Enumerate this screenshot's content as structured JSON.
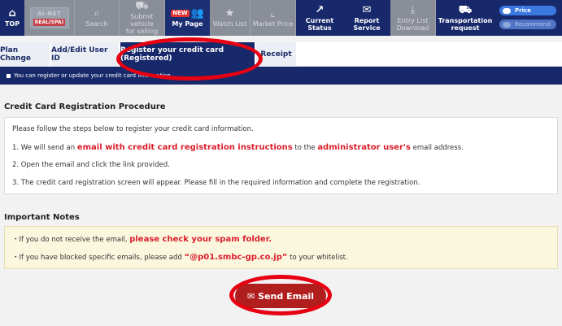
{
  "nav": {
    "top": "TOP",
    "logo_top": "AI-NET",
    "logo_bottom": "REAL(SPA)",
    "search": "Search",
    "submit_vehicle": "Submit vehicle",
    "submit_vehicle_2": "for selling",
    "new_badge": "NEW",
    "my_page": "My Page",
    "watch_list": "Watch List",
    "market_price": "Market Price",
    "current_status": "Current",
    "current_status_2": "Status",
    "report_service": "Report",
    "report_service_2": "Service",
    "entry_list": "Entry List",
    "entry_list_2": "Download",
    "transportation": "Transportation",
    "transportation_2": "request",
    "price_toggle": "Price",
    "recommend_toggle": "Recommend"
  },
  "tabs": [
    "Plan Change",
    "Add/Edit User ID",
    "Register your credit card (Registered)",
    "Receipt"
  ],
  "info_text": "You can register or update your credit card information.",
  "procedure": {
    "title": "Credit Card Registration Procedure",
    "intro": "Please follow the steps below to register your credit card information.",
    "step1_a": "1. We will send an ",
    "step1_b": "email with credit card registration instructions",
    "step1_c": " to the ",
    "step1_d": "administrator user's",
    "step1_e": " email address.",
    "step2": "2. Open the email and click the link provided.",
    "step3": "3. The credit card registration screen will appear. Please fill in the required information and complete the registration."
  },
  "notes": {
    "title": "Important Notes",
    "note1_a": "・If you do not receive the email, ",
    "note1_b": "please check your spam folder.",
    "note2_a": "・If you have blocked specific emails, please add ",
    "note2_b": "“@p01.smbc-gp.co.jp”",
    "note2_c": " to your whitelist."
  },
  "send_button": "Send Email",
  "colors": {
    "navy": "#17296b",
    "accent_red": "#d91e2b",
    "button_red": "#b11e1e",
    "highlight": "#e60012"
  }
}
